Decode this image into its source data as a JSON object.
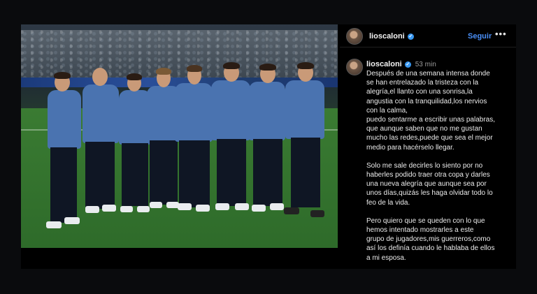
{
  "post": {
    "author": "lioscaloni",
    "follow_label": "Seguir",
    "more_label": "•••",
    "verified_glyph": "✓",
    "time_ago": "53 min",
    "caption": [
      "Después de una semana intensa donde\nse han entrelazado la tristeza con la\nalegría,el llanto con una sonrisa,la\nangustia con la tranquilidad,los nervios\ncon la calma,\npuedo sentarme a escribir unas palabras,\nque aunque saben que no me gustan\nmucho las redes,puede que sea el mejor\nmedio para hacérselo llegar.",
      "Solo me sale decirles lo siento por no\nhaberles podido traer otra copa y darles\nuna nueva alegría que aunque sea por\nunos días,quizás les haga olvidar todo lo\nfeo de la vida.",
      "Pero quiero que se queden con lo que\nhemos intentado mostrarles a este\ngrupo de jugadores,mis guerreros,como\nasí los definía cuando le hablaba de ellos\na mi esposa."
    ]
  },
  "colors": {
    "accent": "#4a8ff7",
    "verified": "#3897f0",
    "background": "#0a0b0d"
  },
  "icons": [
    "verified-badge-icon",
    "more-options-icon"
  ]
}
